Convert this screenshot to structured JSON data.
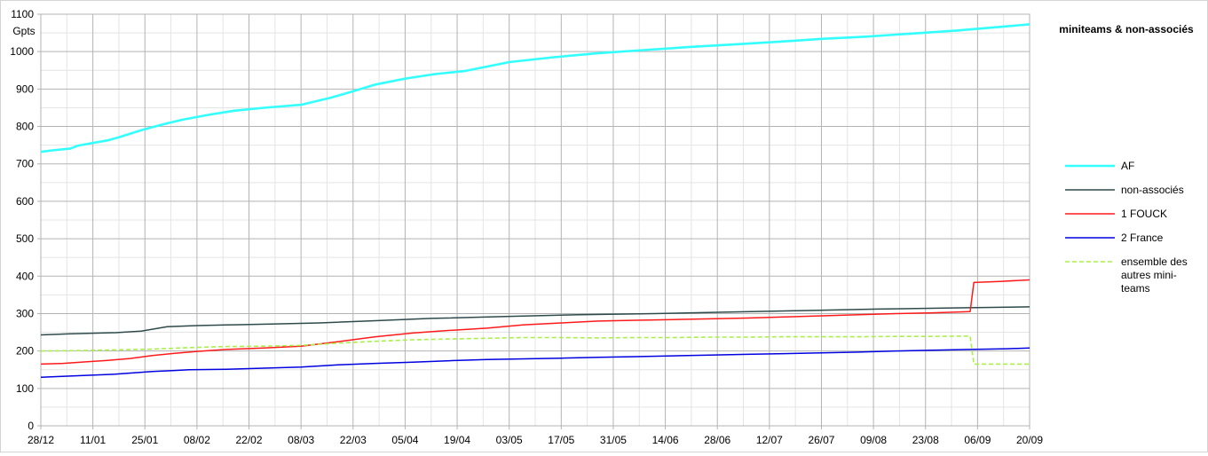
{
  "chart_data": {
    "type": "line",
    "title": "miniteams & non-associés",
    "ylabel": "Gpts",
    "xlabel": "",
    "ylim": [
      0,
      1100
    ],
    "yticks": [
      0,
      100,
      200,
      300,
      400,
      500,
      600,
      700,
      800,
      900,
      1000,
      1100
    ],
    "grid": true,
    "legend_position": "right",
    "x_tick_labels": [
      "28/12",
      "11/01",
      "25/01",
      "08/02",
      "22/02",
      "08/03",
      "22/03",
      "05/04",
      "19/04",
      "03/05",
      "17/05",
      "31/05",
      "14/06",
      "28/06",
      "12/07",
      "26/07",
      "09/08",
      "23/08",
      "06/09",
      "20/09"
    ],
    "x_range_days": [
      0,
      266
    ],
    "series": [
      {
        "name": "AF",
        "color": "#33ffff",
        "style": "solid-thick",
        "points": [
          [
            0,
            732
          ],
          [
            3,
            736
          ],
          [
            8,
            741
          ],
          [
            10,
            749
          ],
          [
            14,
            756
          ],
          [
            18,
            763
          ],
          [
            21,
            771
          ],
          [
            27,
            790
          ],
          [
            33,
            806
          ],
          [
            38,
            818
          ],
          [
            45,
            831
          ],
          [
            52,
            842
          ],
          [
            60,
            850
          ],
          [
            70,
            858
          ],
          [
            78,
            877
          ],
          [
            84,
            894
          ],
          [
            90,
            912
          ],
          [
            98,
            928
          ],
          [
            106,
            940
          ],
          [
            114,
            948
          ],
          [
            126,
            972
          ],
          [
            138,
            985
          ],
          [
            150,
            996
          ],
          [
            162,
            1004
          ],
          [
            174,
            1012
          ],
          [
            186,
            1019
          ],
          [
            198,
            1026
          ],
          [
            210,
            1034
          ],
          [
            222,
            1040
          ],
          [
            234,
            1048
          ],
          [
            246,
            1056
          ],
          [
            258,
            1066
          ],
          [
            266,
            1073
          ]
        ]
      },
      {
        "name": "non-associés",
        "color": "#2e4a4a",
        "style": "solid-step",
        "points": [
          [
            0,
            243
          ],
          [
            8,
            246
          ],
          [
            20,
            249
          ],
          [
            27,
            253
          ],
          [
            34,
            265
          ],
          [
            42,
            268
          ],
          [
            52,
            270
          ],
          [
            62,
            272
          ],
          [
            75,
            275
          ],
          [
            90,
            281
          ],
          [
            105,
            287
          ],
          [
            125,
            292
          ],
          [
            145,
            297
          ],
          [
            165,
            300
          ],
          [
            185,
            304
          ],
          [
            205,
            308
          ],
          [
            225,
            312
          ],
          [
            245,
            315
          ],
          [
            266,
            318
          ]
        ]
      },
      {
        "name": "1 FOUCK",
        "color": "#ff1a1a",
        "style": "solid-step",
        "points": [
          [
            0,
            165
          ],
          [
            6,
            167
          ],
          [
            12,
            171
          ],
          [
            18,
            175
          ],
          [
            24,
            180
          ],
          [
            30,
            188
          ],
          [
            36,
            194
          ],
          [
            42,
            199
          ],
          [
            50,
            204
          ],
          [
            60,
            208
          ],
          [
            70,
            213
          ],
          [
            80,
            225
          ],
          [
            90,
            238
          ],
          [
            100,
            248
          ],
          [
            110,
            255
          ],
          [
            120,
            261
          ],
          [
            130,
            270
          ],
          [
            140,
            275
          ],
          [
            150,
            280
          ],
          [
            160,
            282
          ],
          [
            170,
            284
          ],
          [
            180,
            286
          ],
          [
            190,
            288
          ],
          [
            200,
            291
          ],
          [
            210,
            294
          ],
          [
            220,
            297
          ],
          [
            230,
            300
          ],
          [
            240,
            302
          ],
          [
            250,
            305
          ],
          [
            251,
            383
          ],
          [
            258,
            386
          ],
          [
            266,
            390
          ]
        ]
      },
      {
        "name": "2 France",
        "color": "#0000e0",
        "style": "solid-step",
        "points": [
          [
            0,
            130
          ],
          [
            10,
            134
          ],
          [
            20,
            138
          ],
          [
            30,
            145
          ],
          [
            36,
            148
          ],
          [
            40,
            150
          ],
          [
            50,
            151
          ],
          [
            60,
            154
          ],
          [
            70,
            157
          ],
          [
            80,
            163
          ],
          [
            90,
            167
          ],
          [
            100,
            170
          ],
          [
            110,
            174
          ],
          [
            120,
            177
          ],
          [
            130,
            179
          ],
          [
            140,
            181
          ],
          [
            150,
            183
          ],
          [
            160,
            185
          ],
          [
            170,
            187
          ],
          [
            180,
            189
          ],
          [
            190,
            191
          ],
          [
            200,
            193
          ],
          [
            210,
            195
          ],
          [
            220,
            197
          ],
          [
            230,
            200
          ],
          [
            240,
            202
          ],
          [
            250,
            204
          ],
          [
            260,
            206
          ],
          [
            266,
            208
          ]
        ]
      },
      {
        "name": "ensemble des autres mini-teams",
        "color": "#aaf04a",
        "style": "dashed",
        "points": [
          [
            0,
            200
          ],
          [
            10,
            201
          ],
          [
            20,
            203
          ],
          [
            30,
            205
          ],
          [
            40,
            209
          ],
          [
            50,
            212
          ],
          [
            60,
            213
          ],
          [
            70,
            215
          ],
          [
            80,
            221
          ],
          [
            90,
            226
          ],
          [
            100,
            230
          ],
          [
            110,
            232
          ],
          [
            120,
            234
          ],
          [
            130,
            236
          ],
          [
            140,
            236
          ],
          [
            150,
            235
          ],
          [
            160,
            236
          ],
          [
            170,
            236
          ],
          [
            180,
            237
          ],
          [
            190,
            237
          ],
          [
            200,
            238
          ],
          [
            210,
            238
          ],
          [
            220,
            238
          ],
          [
            230,
            239
          ],
          [
            240,
            239
          ],
          [
            250,
            240
          ],
          [
            251,
            165
          ],
          [
            266,
            165
          ]
        ]
      }
    ]
  }
}
